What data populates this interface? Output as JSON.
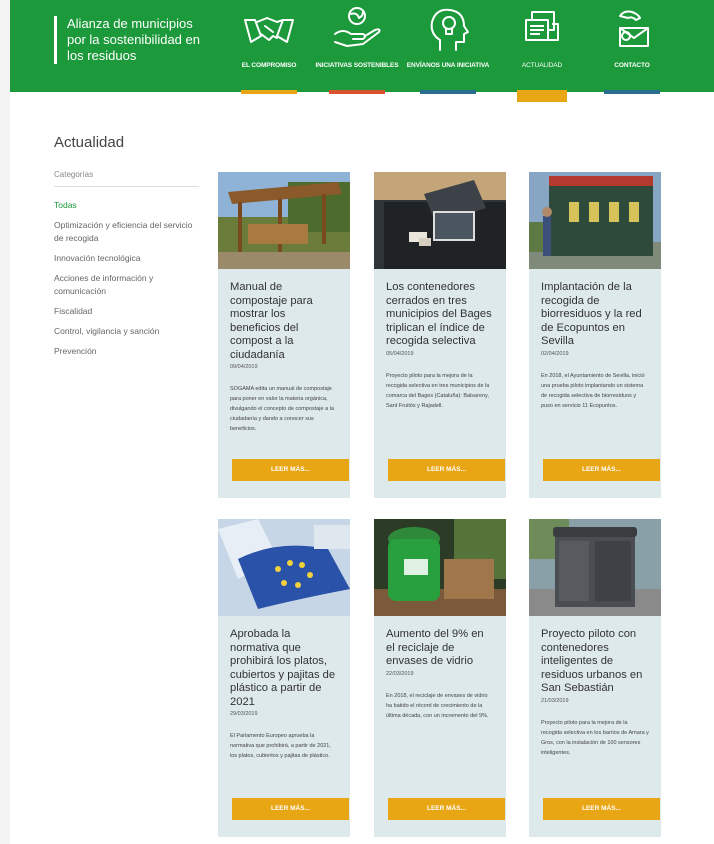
{
  "header": {
    "brand": "Alianza de municipios por la sostenibilidad en los residuos",
    "nav": [
      {
        "label": "EL COMPROMISO",
        "icon": "handshake-icon",
        "underline": "#e8a514"
      },
      {
        "label": "INICIATIVAS SOSTENIBLES",
        "icon": "globe-hand-icon",
        "underline": "#d9522f"
      },
      {
        "label": "ENVÍANOS UNA INICIATIVA",
        "icon": "lightbulb-head-icon",
        "underline": "#2a6e8f"
      },
      {
        "label": "ACTUALIDAD",
        "icon": "news-icon",
        "underline": "#e8a514",
        "active": true
      },
      {
        "label": "CONTACTO",
        "icon": "phone-mail-icon",
        "underline": "#2a6e8f"
      }
    ]
  },
  "section_title": "Actualidad",
  "sidebar": {
    "title": "Categorías",
    "items": [
      "Todas",
      "Optimización y eficiencia del servicio de recogida",
      "Innovación tecnológica",
      "Acciones de información y comunicación",
      "Fiscalidad",
      "Control, vigilancia y sanción",
      "Prevención"
    ]
  },
  "cards": [
    {
      "title": "Manual de compostaje para mostrar los beneficios del compost a la ciudadanía",
      "date": "09/04/2019",
      "text": "SOGAMA edita un manual de compostaje para poner en valor la materia orgánica, divulgando el concepto de compostaje a la ciudadanía y dando a conocer sus beneficios.",
      "button": "LEER MÁS...",
      "image": "compost-shelter"
    },
    {
      "title": "Los contenedores cerrados en tres municipios del Bages triplican el índice de recogida selectiva",
      "date": "05/04/2019",
      "text": "Proyecto piloto para la mejora de la recogida selectiva en tres municipios de la comarca del Bages (Cataluña): Balsareny, Sant Fruitós y Rajadell.",
      "button": "LEER MÁS...",
      "image": "closed-container"
    },
    {
      "title": "Implantación de la recogida de biorresiduos y la red de Ecopuntos en Sevilla",
      "date": "02/04/2019",
      "text": "En 2018, el Ayuntamiento de Sevilla, inició una prueba piloto implantando un sistema de recogida selectiva de biorresiduos y puso en servicio 11 Ecopuntos.",
      "button": "LEER MÁS...",
      "image": "ecopunto"
    },
    {
      "title": "Aprobada la normativa que prohibirá los platos, cubiertos y pajitas de plástico a partir de 2021",
      "date": "29/03/2019",
      "text": "El Parlamento Europeo aprueba la normativa que prohibirá, a partir de 2021, los platos, cubiertos y pajitas de plástico.",
      "button": "LEER MÁS...",
      "image": "eu-flag"
    },
    {
      "title": "Aumento del 9% en el reciclaje de envases de vidrio",
      "date": "22/03/2019",
      "text": "En 2018, el reciclaje de envases de vidrio ha batido el récord de crecimiento de la última década, con un incremento del 9%.",
      "button": "LEER MÁS...",
      "image": "glass-bin"
    },
    {
      "title": "Proyecto piloto con contenedores inteligentes de residuos urbanos en San Sebastián",
      "date": "21/03/2019",
      "text": "Proyecto piloto para la mejora de la recogida selectiva en los barrios de Amara y Gros, con la instalación de 100 sensores inteligentes.",
      "button": "LEER MÁS...",
      "image": "smart-bin"
    }
  ],
  "colors": {
    "green": "#1c9a3b",
    "orange": "#e8a514",
    "card_bg": "#dde9ea"
  }
}
